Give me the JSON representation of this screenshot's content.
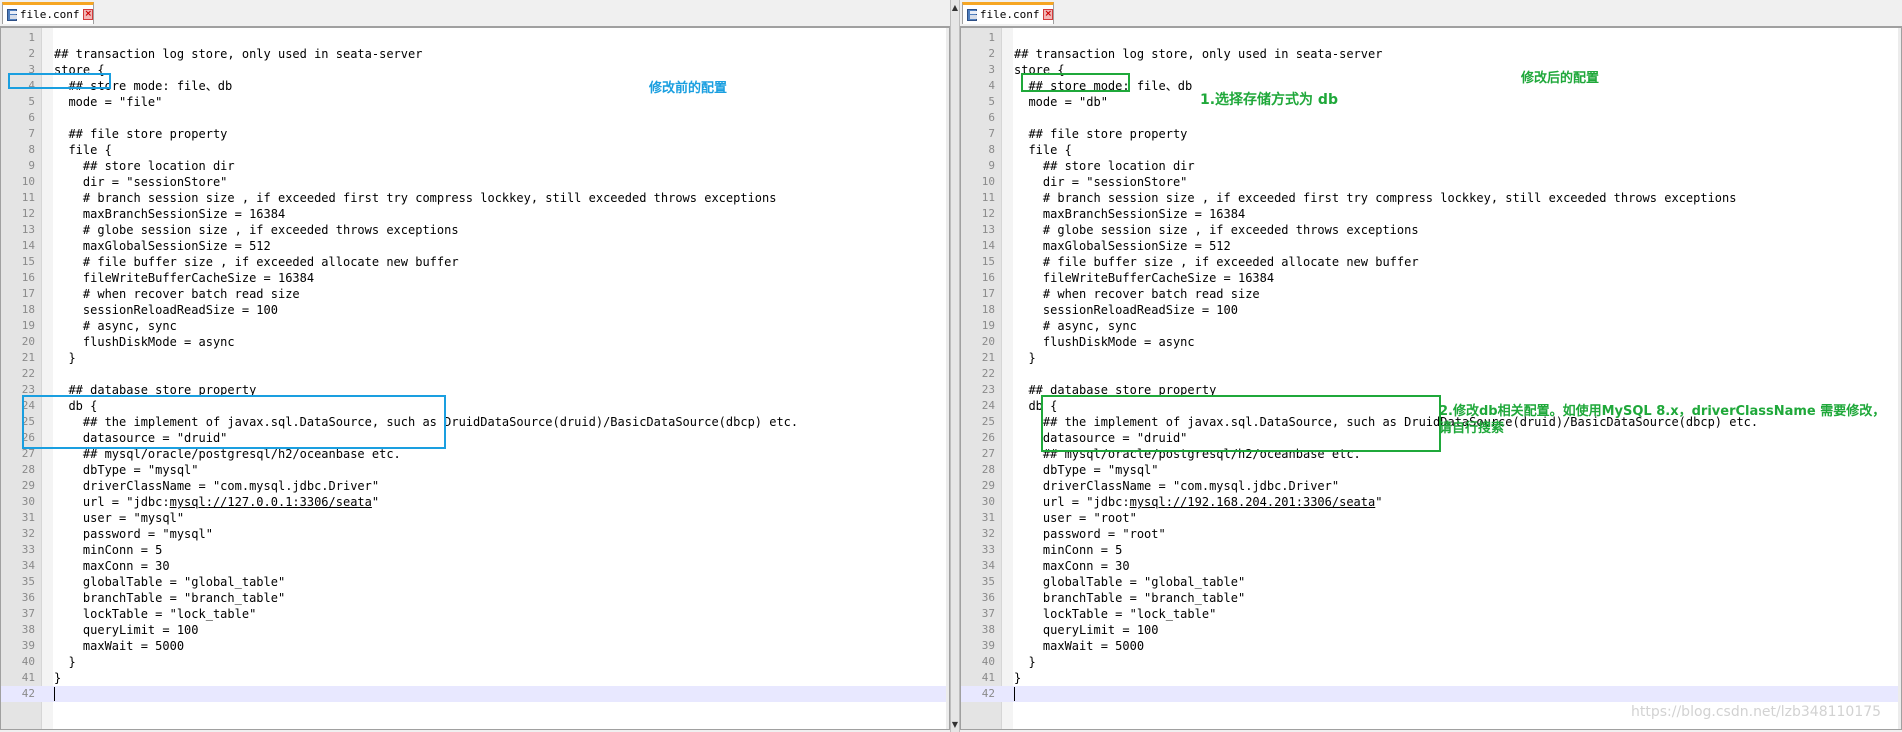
{
  "colors": {
    "blue_annotation": "#1a9fe0",
    "green_annotation": "#1fa83a",
    "tab_accent": "#f6a623",
    "current_line": "#e8e8ff"
  },
  "panes": [
    {
      "id": "left",
      "tab": {
        "label": "file.conf",
        "icons": [
          "save-icon",
          "close-icon"
        ]
      },
      "lines": [
        "",
        "## transaction log store, only used in seata-server",
        "store {",
        "  ## store mode: file、db",
        "  mode = \"file\"",
        "",
        "  ## file store property",
        "  file {",
        "    ## store location dir",
        "    dir = \"sessionStore\"",
        "    # branch session size , if exceeded first try compress lockkey, still exceeded throws exceptions",
        "    maxBranchSessionSize = 16384",
        "    # globe session size , if exceeded throws exceptions",
        "    maxGlobalSessionSize = 512",
        "    # file buffer size , if exceeded allocate new buffer",
        "    fileWriteBufferCacheSize = 16384",
        "    # when recover batch read size",
        "    sessionReloadReadSize = 100",
        "    # async, sync",
        "    flushDiskMode = async",
        "  }",
        "",
        "  ## database store property",
        "  db {",
        "    ## the implement of javax.sql.DataSource, such as DruidDataSource(druid)/BasicDataSource(dbcp) etc.",
        "    datasource = \"druid\"",
        "    ## mysql/oracle/postgresql/h2/oceanbase etc.",
        "    dbType = \"mysql\"",
        "    driverClassName = \"com.mysql.jdbc.Driver\"",
        "    url = \"jdbc:mysql://127.0.0.1:3306/seata\"",
        "    user = \"mysql\"",
        "    password = \"mysql\"",
        "    minConn = 5",
        "    maxConn = 30",
        "    globalTable = \"global_table\"",
        "    branchTable = \"branch_table\"",
        "    lockTable = \"lock_table\"",
        "    queryLimit = 100",
        "    maxWait = 5000",
        "  }",
        "}",
        ""
      ],
      "annotations": [
        {
          "text": "修改前的配置",
          "color": "#1a9fe0"
        }
      ]
    },
    {
      "id": "right",
      "tab": {
        "label": "file.conf",
        "icons": [
          "save-icon",
          "close-icon"
        ]
      },
      "lines": [
        "",
        "## transaction log store, only used in seata-server",
        "store {",
        "  ## store mode: file、db",
        "  mode = \"db\"",
        "",
        "  ## file store property",
        "  file {",
        "    ## store location dir",
        "    dir = \"sessionStore\"",
        "    # branch session size , if exceeded first try compress lockkey, still exceeded throws exceptions",
        "    maxBranchSessionSize = 16384",
        "    # globe session size , if exceeded throws exceptions",
        "    maxGlobalSessionSize = 512",
        "    # file buffer size , if exceeded allocate new buffer",
        "    fileWriteBufferCacheSize = 16384",
        "    # when recover batch read size",
        "    sessionReloadReadSize = 100",
        "    # async, sync",
        "    flushDiskMode = async",
        "  }",
        "",
        "  ## database store property",
        "  db {",
        "    ## the implement of javax.sql.DataSource, such as DruidDataSource(druid)/BasicDataSource(dbcp) etc.",
        "    datasource = \"druid\"",
        "    ## mysql/oracle/postgresql/h2/oceanbase etc.",
        "    dbType = \"mysql\"",
        "    driverClassName = \"com.mysql.jdbc.Driver\"",
        "    url = \"jdbc:mysql://192.168.204.201:3306/seata\"",
        "    user = \"root\"",
        "    password = \"root\"",
        "    minConn = 5",
        "    maxConn = 30",
        "    globalTable = \"global_table\"",
        "    branchTable = \"branch_table\"",
        "    lockTable = \"lock_table\"",
        "    queryLimit = 100",
        "    maxWait = 5000",
        "  }",
        "}",
        ""
      ],
      "annotations": [
        {
          "text": "修改后的配置",
          "color": "#1fa83a"
        },
        {
          "text": "1.选择存储方式为 db",
          "color": "#1fa83a"
        },
        {
          "text": "2.修改db相关配置。如使用MySQL 8.x，driverClassName 需要修改，",
          "color": "#1fa83a"
        },
        {
          "text": "请自行搜索",
          "color": "#1fa83a"
        }
      ],
      "watermark": "https://blog.csdn.net/lzb348110175"
    }
  ],
  "current_line": 42
}
